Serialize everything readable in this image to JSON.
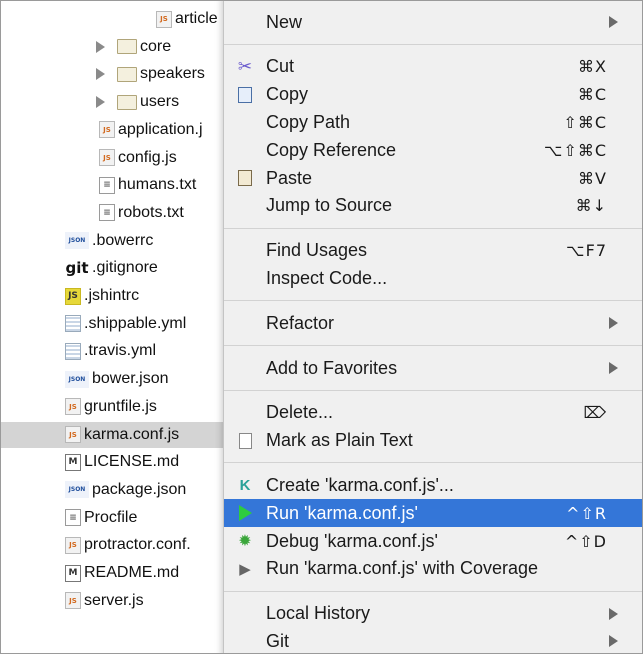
{
  "tree": {
    "items": [
      {
        "label": "article",
        "icon": "js-file-icon",
        "indent": 155,
        "arrow": false
      },
      {
        "label": "core",
        "icon": "folder-icon",
        "indent": 95,
        "arrow": true
      },
      {
        "label": "speakers",
        "icon": "folder-icon",
        "indent": 95,
        "arrow": true
      },
      {
        "label": "users",
        "icon": "folder-icon",
        "indent": 95,
        "arrow": true
      },
      {
        "label": "application.j",
        "icon": "js-file-icon",
        "indent": 98,
        "arrow": false
      },
      {
        "label": "config.js",
        "icon": "js-file-icon",
        "indent": 98,
        "arrow": false
      },
      {
        "label": "humans.txt",
        "icon": "text-file-icon",
        "indent": 98,
        "arrow": false
      },
      {
        "label": "robots.txt",
        "icon": "text-file-icon",
        "indent": 98,
        "arrow": false
      },
      {
        "label": ".bowerrc",
        "icon": "json-file-icon",
        "indent": 64,
        "arrow": false
      },
      {
        "label": ".gitignore",
        "icon": "git-file-icon",
        "indent": 64,
        "arrow": false
      },
      {
        "label": ".jshintrc",
        "icon": "jshint-file-icon",
        "indent": 64,
        "arrow": false
      },
      {
        "label": ".shippable.yml",
        "icon": "yml-file-icon",
        "indent": 64,
        "arrow": false
      },
      {
        "label": ".travis.yml",
        "icon": "yml-file-icon",
        "indent": 64,
        "arrow": false
      },
      {
        "label": "bower.json",
        "icon": "json-file-icon",
        "indent": 64,
        "arrow": false
      },
      {
        "label": "gruntfile.js",
        "icon": "js-file-icon",
        "indent": 64,
        "arrow": false
      },
      {
        "label": "karma.conf.js",
        "icon": "js-file-icon",
        "indent": 64,
        "arrow": false,
        "selected": true
      },
      {
        "label": "LICENSE.md",
        "icon": "markdown-file-icon",
        "indent": 64,
        "arrow": false
      },
      {
        "label": "package.json",
        "icon": "json-file-icon",
        "indent": 64,
        "arrow": false
      },
      {
        "label": "Procfile",
        "icon": "text-file-icon",
        "indent": 64,
        "arrow": false
      },
      {
        "label": "protractor.conf.",
        "icon": "js-file-icon",
        "indent": 64,
        "arrow": false
      },
      {
        "label": "README.md",
        "icon": "markdown-file-icon",
        "indent": 64,
        "arrow": false
      },
      {
        "label": "server.js",
        "icon": "js-file-icon",
        "indent": 64,
        "arrow": false
      }
    ]
  },
  "menu": {
    "items": [
      {
        "type": "item",
        "label": "New",
        "submenu": true
      },
      {
        "type": "sep"
      },
      {
        "type": "item",
        "label": "Cut",
        "icon": "scissors-icon",
        "shortcut": "⌘X"
      },
      {
        "type": "item",
        "label": "Copy",
        "icon": "copy-icon",
        "shortcut": "⌘C"
      },
      {
        "type": "item",
        "label": "Copy Path",
        "shortcut": "⇧⌘C"
      },
      {
        "type": "item",
        "label": "Copy Reference",
        "shortcut": "⌥⇧⌘C"
      },
      {
        "type": "item",
        "label": "Paste",
        "icon": "paste-icon",
        "shortcut": "⌘V"
      },
      {
        "type": "item",
        "label": "Jump to Source",
        "shortcut": "⌘↓"
      },
      {
        "type": "sep"
      },
      {
        "type": "item",
        "label": "Find Usages",
        "shortcut": "⌥F7"
      },
      {
        "type": "item",
        "label": "Inspect Code..."
      },
      {
        "type": "sep"
      },
      {
        "type": "item",
        "label": "Refactor",
        "submenu": true
      },
      {
        "type": "sep"
      },
      {
        "type": "item",
        "label": "Add to Favorites",
        "submenu": true
      },
      {
        "type": "sep"
      },
      {
        "type": "item",
        "label": "Delete...",
        "shortcut": "⌦"
      },
      {
        "type": "item",
        "label": "Mark as Plain Text",
        "icon": "plain-text-icon"
      },
      {
        "type": "sep"
      },
      {
        "type": "item",
        "label": "Create 'karma.conf.js'...",
        "icon": "karma-icon"
      },
      {
        "type": "item",
        "label": "Run 'karma.conf.js'",
        "icon": "run-icon",
        "shortcut": "^⇧R",
        "highlight": true
      },
      {
        "type": "item",
        "label": "Debug 'karma.conf.js'",
        "icon": "debug-icon",
        "shortcut": "^⇧D"
      },
      {
        "type": "item",
        "label": "Run 'karma.conf.js' with Coverage",
        "icon": "coverage-icon"
      },
      {
        "type": "sep"
      },
      {
        "type": "item",
        "label": "Local History",
        "submenu": true
      },
      {
        "type": "item",
        "label": "Git",
        "submenu": true
      }
    ]
  },
  "colors": {
    "highlight": "#3476d8",
    "selection": "#d4d4d4",
    "menu_bg": "#f0f0f0"
  }
}
